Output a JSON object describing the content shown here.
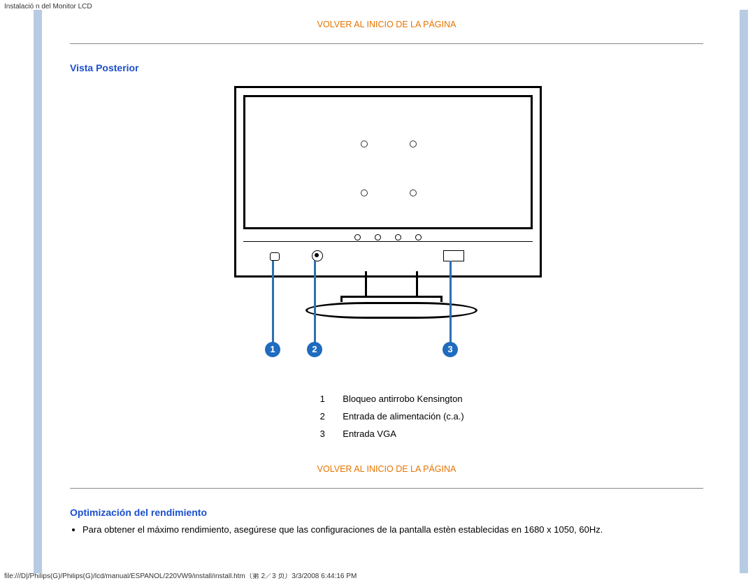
{
  "meta": {
    "header": "Instalació n del Monitor LCD",
    "footer": "file:///D|/Philips(G)/Philips(G)/lcd/manual/ESPANOL/220VW9/install/install.htm（第 2／3 页）3/3/2008 6:44:16 PM"
  },
  "content": {
    "back_to_top1": "VOLVER AL INICIO DE LA PÁGINA",
    "back_to_top2": "VOLVER AL INICIO DE LA PÁGINA",
    "section1_title": "Vista Posterior",
    "section2_title": "Optimización del rendimiento",
    "opt_bullet1": "Para obtener el máximo rendimiento, asegúrese que las configuraciones de la pantalla estèn establecidas en 1680 x 1050, 60Hz."
  },
  "diagram": {
    "marker1": "1",
    "marker2": "2",
    "marker3": "3"
  },
  "legend": {
    "row1_num": "1",
    "row1_label": "Bloqueo antirrobo Kensington",
    "row2_num": "2",
    "row2_label": "Entrada de alimentación (c.a.)",
    "row3_num": "3",
    "row3_label": "Entrada VGA"
  }
}
